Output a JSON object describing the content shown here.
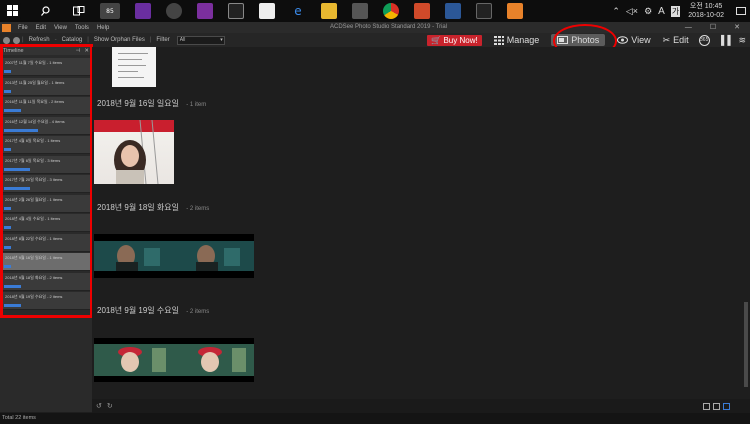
{
  "taskbar": {
    "badge": "85",
    "tray_lang": "A",
    "tray_ime": "가",
    "clock_period": "오전",
    "clock_time": "10:45",
    "clock_date": "2018-10-02"
  },
  "menubar": {
    "items": [
      "File",
      "Edit",
      "View",
      "Tools",
      "Help"
    ],
    "window_title": "ACDSee Photo Studio Standard 2019 - Trial"
  },
  "toolbar": {
    "refresh": "Refresh",
    "catalog": "Catalog",
    "show_orphan": "Show Orphan Files",
    "filter_label": "Filter",
    "filter_value": "All"
  },
  "modes": {
    "buy_now": "Buy Now!",
    "manage": "Manage",
    "photos": "Photos",
    "view": "View",
    "edit": "Edit",
    "extra": "365"
  },
  "timeline": {
    "title": "Timeline",
    "items": [
      {
        "label": "2007년 11월 7일 수요일 - 1 items",
        "fill": 0.08,
        "selected": false
      },
      {
        "label": "2013년 11월 25일 월요일 - 1 items",
        "fill": 0.08,
        "selected": false
      },
      {
        "label": "2016년 11월 11일 목요일 - 2 items",
        "fill": 0.2,
        "selected": false
      },
      {
        "label": "2016년 12월 14일 수요일 - 4 items",
        "fill": 0.4,
        "selected": false
      },
      {
        "label": "2017년 4월 6일 목요일 - 1 items",
        "fill": 0.08,
        "selected": false
      },
      {
        "label": "2017년 7월 6일 목요일 - 3 items",
        "fill": 0.3,
        "selected": false
      },
      {
        "label": "2017년 7월 20일 목요일 - 3 items",
        "fill": 0.3,
        "selected": false
      },
      {
        "label": "2018년 2월 26일 월요일 - 1 items",
        "fill": 0.08,
        "selected": false
      },
      {
        "label": "2018년 4월 4일 수요일 - 1 items",
        "fill": 0.08,
        "selected": false
      },
      {
        "label": "2018년 8월 22일 수요일 - 1 items",
        "fill": 0.08,
        "selected": false
      },
      {
        "label": "2018년 9월 16일 일요일 - 1 items",
        "fill": 0.08,
        "selected": true
      },
      {
        "label": "2018년 9월 18일 화요일 - 2 items",
        "fill": 0.2,
        "selected": false
      },
      {
        "label": "2018년 9월 19일 수요일 - 2 items",
        "fill": 0.2,
        "selected": false
      }
    ]
  },
  "groups": [
    {
      "date": "2018년 9월 16일 일요일",
      "count": "- 1 item"
    },
    {
      "date": "2018년 9월 18일 화요일",
      "count": "- 2 items"
    },
    {
      "date": "2018년 9월 19일 수요일",
      "count": "- 2 items"
    }
  ],
  "status": {
    "total": "Total 22 items"
  }
}
